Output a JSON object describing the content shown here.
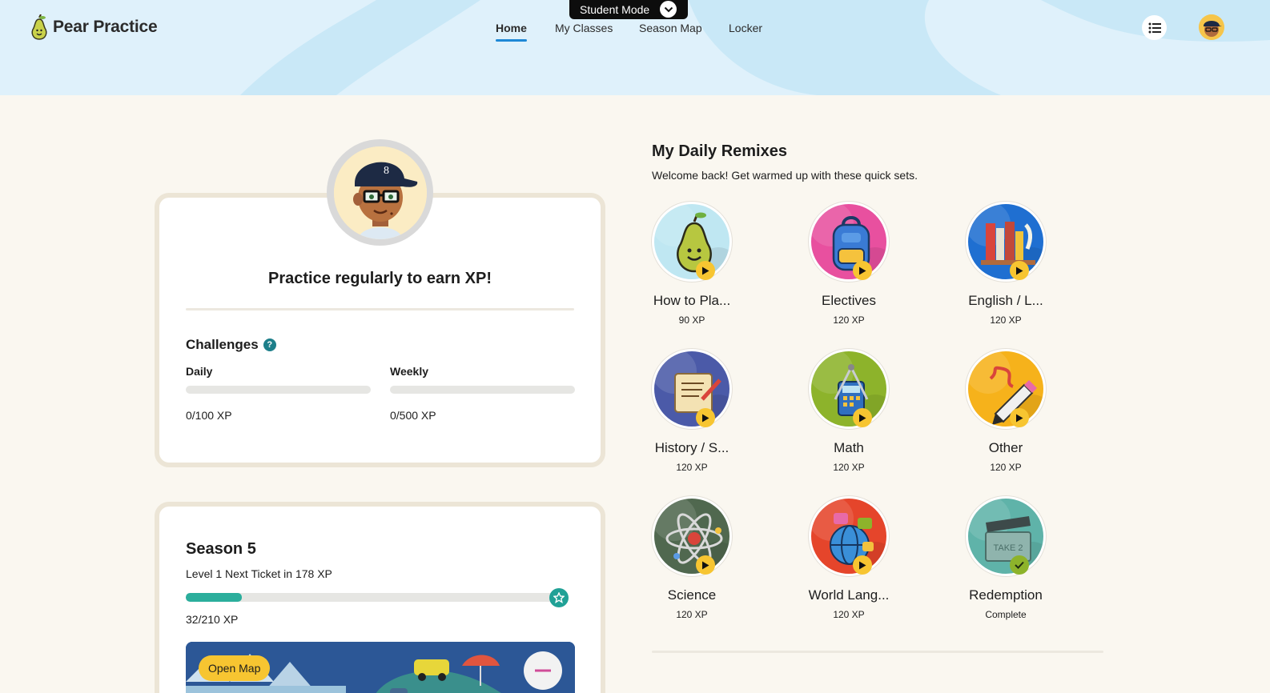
{
  "header": {
    "app_name": "Pear Practice",
    "student_mode_label": "Student Mode",
    "nav": [
      {
        "label": "Home",
        "active": true
      },
      {
        "label": "My Classes",
        "active": false
      },
      {
        "label": "Season Map",
        "active": false
      },
      {
        "label": "Locker",
        "active": false
      }
    ],
    "icons": {
      "logo": "pear-logo-icon",
      "menu": "list-menu-icon",
      "avatar": "user-avatar",
      "mode": "chevron-down-icon"
    }
  },
  "challenges_card": {
    "title": "Practice regularly to earn XP!",
    "challenges_label": "Challenges",
    "help_glyph": "?",
    "daily": {
      "label": "Daily",
      "value": "0/100 XP",
      "progress": 0
    },
    "weekly": {
      "label": "Weekly",
      "value": "0/500 XP",
      "progress": 0
    }
  },
  "season_card": {
    "title": "Season 5",
    "subtitle": "Level 1 Next Ticket in 178 XP",
    "progress_text": "32/210 XP",
    "progress": 0.152,
    "open_map_label": "Open Map"
  },
  "remixes": {
    "title": "My Daily Remixes",
    "subtitle": "Welcome back! Get warmed up with these quick sets.",
    "items": [
      {
        "name": "How to Pla...",
        "xp": "90 XP",
        "color": "#bfe7f2",
        "icon": "pear-icon",
        "status": "play"
      },
      {
        "name": "Electives",
        "xp": "120 XP",
        "color": "#e8509f",
        "icon": "backpack-icon",
        "status": "play"
      },
      {
        "name": "English / L...",
        "xp": "120 XP",
        "color": "#1f6fd1",
        "icon": "books-icon",
        "status": "play"
      },
      {
        "name": "History / S...",
        "xp": "120 XP",
        "color": "#4b5aa8",
        "icon": "scroll-icon",
        "status": "play"
      },
      {
        "name": "Math",
        "xp": "120 XP",
        "color": "#8db32b",
        "icon": "calculator-icon",
        "status": "play"
      },
      {
        "name": "Other",
        "xp": "120 XP",
        "color": "#f6b21b",
        "icon": "pencil-icon",
        "status": "play"
      },
      {
        "name": "Science",
        "xp": "120 XP",
        "color": "#50684f",
        "icon": "atom-icon",
        "status": "play"
      },
      {
        "name": "World Lang...",
        "xp": "120 XP",
        "color": "#e5452b",
        "icon": "globe-icon",
        "status": "play"
      },
      {
        "name": "Redemption",
        "xp": "Complete",
        "color": "#5fb3a9",
        "icon": "clapperboard-icon",
        "status": "complete",
        "clapper_text": "TAKE 2"
      }
    ]
  }
}
